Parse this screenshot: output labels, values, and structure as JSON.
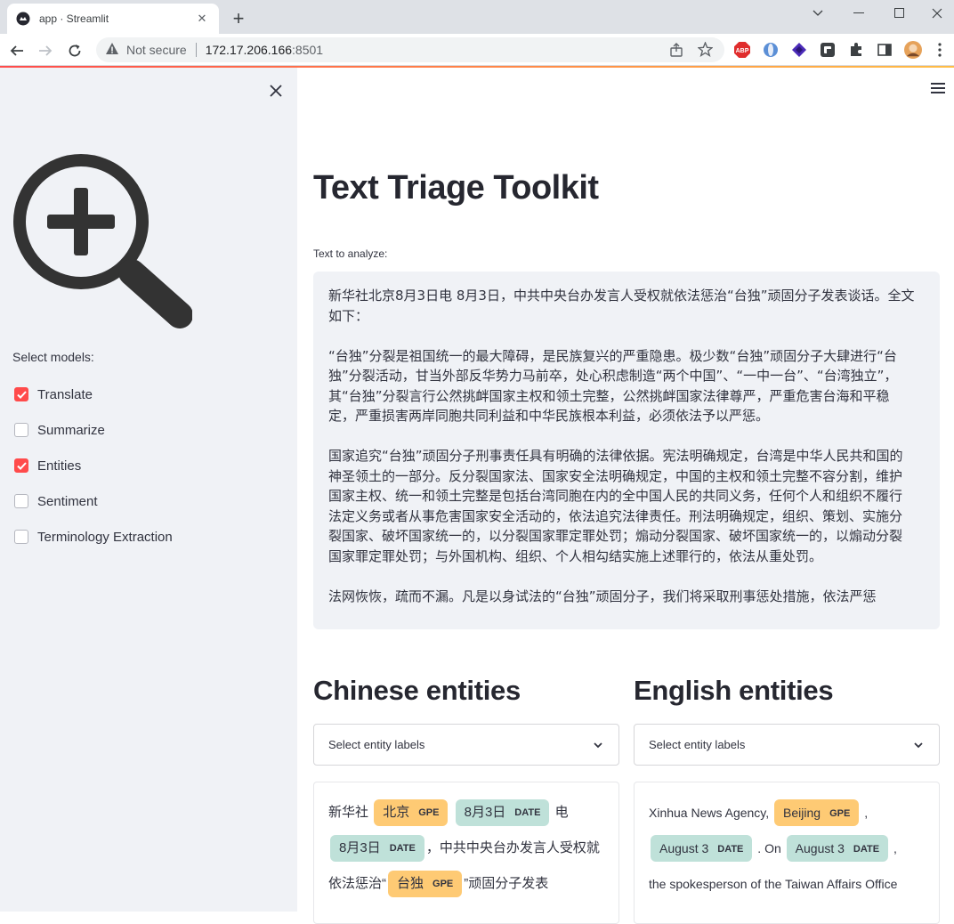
{
  "browser": {
    "tab_title": "app · Streamlit",
    "security_label": "Not secure",
    "url_host": "172.17.206.166",
    "url_port": ":8501",
    "extensions": [
      "abp-icon",
      "extension-icon",
      "extension-icon",
      "extension-icon",
      "puzzle-icon",
      "sidebar-icon",
      "avatar"
    ]
  },
  "sidebar": {
    "heading": "Select models:",
    "models": [
      {
        "label": "Translate",
        "checked": true
      },
      {
        "label": "Summarize",
        "checked": false
      },
      {
        "label": "Entities",
        "checked": true
      },
      {
        "label": "Sentiment",
        "checked": false
      },
      {
        "label": "Terminology Extraction",
        "checked": false
      }
    ]
  },
  "main": {
    "title": "Text Triage Toolkit",
    "textarea_label": "Text to analyze:",
    "text_paragraphs": [
      "新华社北京8月3日电 8月3日，中共中央台办发言人受权就依法惩治“台独”顽固分子发表谈话。全文如下：",
      "“台独”分裂是祖国统一的最大障碍，是民族复兴的严重隐患。极少数“台独”顽固分子大肆进行“台独”分裂活动，甘当外部反华势力马前卒，处心积虑制造“两个中国”、“一中一台”、“台湾独立”，其“台独”分裂言行公然挑衅国家主权和领土完整，公然挑衅国家法律尊严，严重危害台海和平稳定，严重损害两岸同胞共同利益和中华民族根本利益，必须依法予以严惩。",
      "国家追究“台独”顽固分子刑事责任具有明确的法律依据。宪法明确规定，台湾是中华人民共和国的神圣领土的一部分。反分裂国家法、国家安全法明确规定，中国的主权和领土完整不容分割，维护国家主权、统一和领土完整是包括台湾同胞在内的全中国人民的共同义务，任何个人和组织不履行法定义务或者从事危害国家安全活动的，依法追究法律责任。刑法明确规定，组织、策划、实施分裂国家、破坏国家统一的，以分裂国家罪定罪处罚；煽动分裂国家、破坏国家统一的，以煽动分裂国家罪定罪处罚；与外国机构、组织、个人相勾结实施上述罪行的，依法从重处罚。",
      "法网恢恢，疏而不漏。凡是以身试法的“台独”顽固分子，我们将采取刑事惩处措施，依法严惩"
    ],
    "chinese": {
      "heading": "Chinese entities",
      "select_placeholder": "Select entity labels",
      "t1": "新华社",
      "e1": {
        "text": "北京",
        "label": "GPE"
      },
      "e2": {
        "text": "8月3日",
        "label": "DATE"
      },
      "t2": "电",
      "e3": {
        "text": "8月3日",
        "label": "DATE"
      },
      "t3": "，中共中央台办发言人受权就依法惩治“",
      "e4": {
        "text": "台独",
        "label": "GPE"
      },
      "t4": "”顽固分子发表"
    },
    "english": {
      "heading": "English entities",
      "select_placeholder": "Select entity labels",
      "t1": "Xinhua News Agency,",
      "e1": {
        "text": "Beijing",
        "label": "GPE"
      },
      "t2": ",",
      "e2": {
        "text": "August 3",
        "label": "DATE"
      },
      "t3": ". On",
      "e3": {
        "text": "August 3",
        "label": "DATE"
      },
      "t4": ",",
      "t5": "the spokesperson of the Taiwan Affairs Office"
    }
  },
  "colors": {
    "accent": "#ff4b4b",
    "gpe": "#feca74",
    "date": "#bfe1d9",
    "sidebar_bg": "#f0f2f6"
  }
}
